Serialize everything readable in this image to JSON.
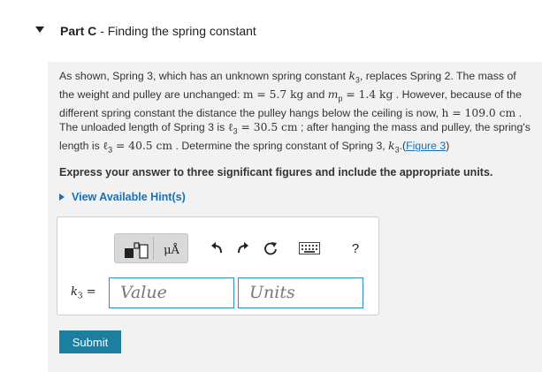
{
  "header": {
    "part_label": "Part C",
    "separator": " - ",
    "part_title": "Finding the spring constant"
  },
  "problem": {
    "s1": "As shown, Spring 3, which has an unknown spring constant ",
    "k3": "k",
    "k3_sub": "3",
    "s2": ", replaces Spring 2. The mass of the weight and pulley are unchanged: ",
    "m_expr": "m = 5.7 kg",
    "s3": " and ",
    "mp_expr": "m",
    "mp_sub": "p",
    "mp_val": " = 1.4 kg",
    "s4": " . However, because of the different spring constant the distance the pulley hangs below the ceiling is now, ",
    "h_expr": "h = 109.0 cm",
    "s5": " . The unloaded length of Spring 3 is ",
    "l3p_sym": "ℓ",
    "l3p_sub": "3",
    "l3p_val": " = 30.5 cm",
    "s6": " ; after hanging the mass and pulley, the spring's length is ",
    "l3_sym": "ℓ",
    "l3_sub": "3",
    "l3_val": " = 40.5 cm",
    "s7": " . Determine the spring constant of Spring 3, ",
    "k3b": "k",
    "k3b_sub": "3",
    "s8": ".(",
    "figure_link": "Figure 3",
    "s9": ")"
  },
  "instruction": "Express your answer to three significant figures and include the appropriate units.",
  "hints_label": "View Available Hint(s)",
  "toolbar": {
    "micro_angstrom": "μÅ",
    "help": "?",
    "icons": [
      "templates-icon",
      "micro-angstrom-icon",
      "undo-icon",
      "redo-icon",
      "reset-icon",
      "keyboard-icon",
      "help-icon"
    ]
  },
  "answer": {
    "var_symbol": "k",
    "var_sub": "3",
    "equals": " =",
    "value_placeholder": "Value",
    "units_placeholder": "Units"
  },
  "submit_label": "Submit",
  "colors": {
    "link": "#1a6fb5",
    "submit_bg": "#1c7fa0",
    "field_border": "#2b8fc7",
    "panel_bg": "#f2f2f2"
  }
}
